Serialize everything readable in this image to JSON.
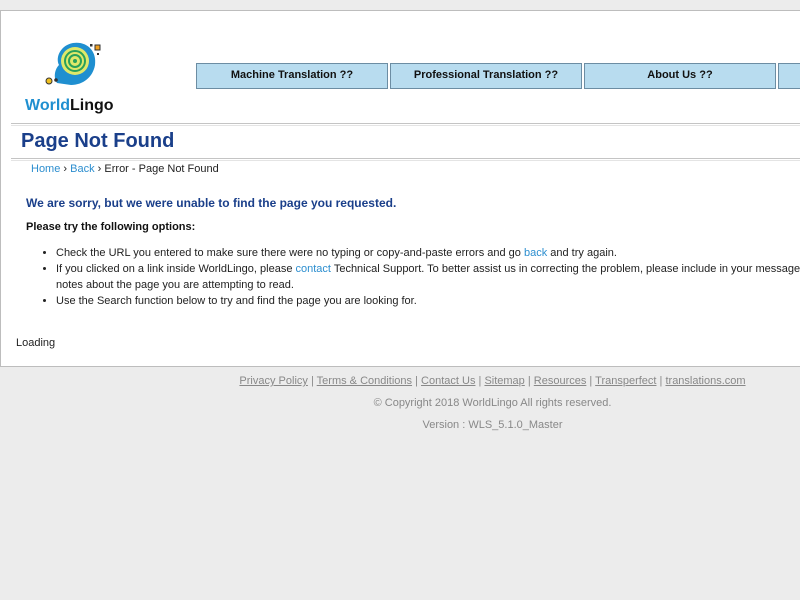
{
  "logo": {
    "part1": "World",
    "part2": "Lingo"
  },
  "nav": [
    {
      "label": "Machine Translation ??"
    },
    {
      "label": "Professional Translation ??"
    },
    {
      "label": "About Us ??"
    },
    {
      "label": ""
    }
  ],
  "page": {
    "title": "Page Not Found"
  },
  "breadcrumb": {
    "home": "Home",
    "sep1": "›",
    "back": "Back",
    "sep2": "›",
    "current": "Error - Page Not Found"
  },
  "content": {
    "sorry": "We are sorry, but we were unable to find the page you requested.",
    "options_heading": "Please try the following options:",
    "items": [
      {
        "pre": "Check the URL you entered to make sure there were no typing or copy-and-paste errors and go ",
        "link": "back",
        "post": " and try again."
      },
      {
        "pre": "If you clicked on a link inside WorldLingo, please ",
        "link": "contact",
        "post": " Technical Support. To better assist us in correcting the problem, please include in your message notes about the page you are attempting to read."
      },
      {
        "text": "Use the Search function below to try and find the page you are looking for."
      }
    ],
    "loading": "Loading"
  },
  "footer": {
    "links": [
      "Privacy Policy",
      "Terms & Conditions",
      "Contact Us",
      "Sitemap",
      "Resources",
      "Transperfect",
      "translations.com"
    ],
    "separator": "|",
    "copyright": "© Copyright 2018 WorldLingo All rights reserved.",
    "version": "Version : WLS_5.1.0_Master"
  },
  "colors": {
    "title": "#1a3f8a",
    "link": "#2c8ecf",
    "nav_bg": "#b8dcef",
    "logo_world": "#1f8fd0"
  }
}
